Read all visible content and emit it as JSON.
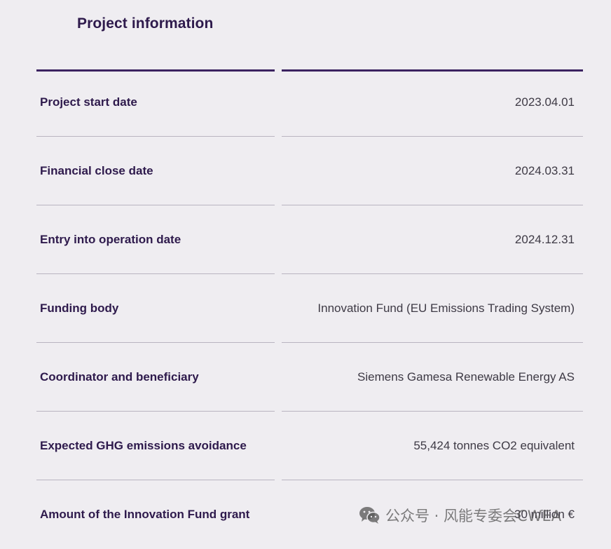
{
  "section": {
    "title": "Project information"
  },
  "rows": [
    {
      "label": "Project start date",
      "value": "2023.04.01"
    },
    {
      "label": "Financial close date",
      "value": "2024.03.31"
    },
    {
      "label": "Entry into operation date",
      "value": "2024.12.31"
    },
    {
      "label": "Funding body",
      "value": "Innovation Fund (EU Emissions Trading System)"
    },
    {
      "label": "Coordinator and beneficiary",
      "value": "Siemens Gamesa Renewable Energy AS"
    },
    {
      "label": "Expected GHG emissions avoidance",
      "value": "55,424 tonnes CO2 equivalent"
    },
    {
      "label": "Amount of the Innovation Fund grant",
      "value": "30 million €"
    }
  ],
  "watermark": {
    "icon": "wechat-icon",
    "text": "公众号 · 风能专委会CWEA"
  },
  "colors": {
    "background": "#efedf1",
    "heading": "#2e1a4c",
    "accent_rule": "#3b2260",
    "divider": "#b9b4c0",
    "value_text": "#3e3a45"
  }
}
